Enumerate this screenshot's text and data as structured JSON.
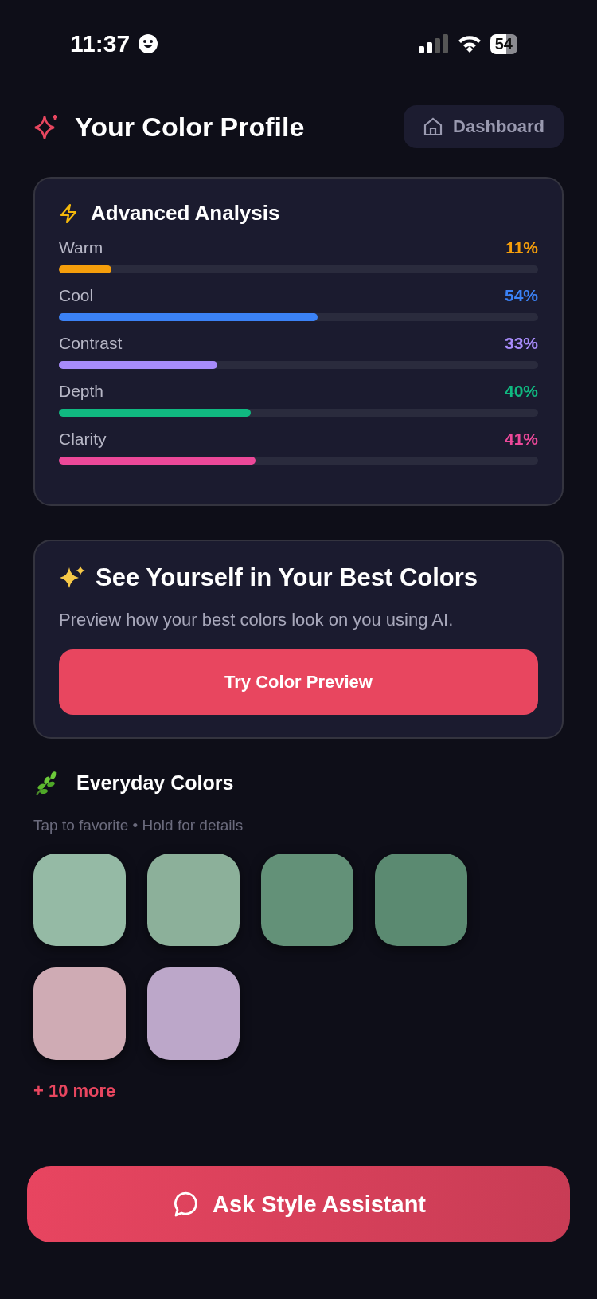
{
  "status_bar": {
    "time": "11:37",
    "battery": "54"
  },
  "header": {
    "title": "Your Color Profile",
    "dashboard_button": "Dashboard"
  },
  "analysis": {
    "title": "Advanced Analysis",
    "metrics": [
      {
        "name": "Warm",
        "reading": "11%",
        "level": 0.11,
        "color": "#f59e0b"
      },
      {
        "name": "Cool",
        "reading": "54%",
        "level": 0.54,
        "color": "#3b82f6"
      },
      {
        "name": "Contrast",
        "reading": "33%",
        "level": 0.33,
        "color": "#a78bfa"
      },
      {
        "name": "Depth",
        "reading": "40%",
        "level": 0.4,
        "color": "#10b981"
      },
      {
        "name": "Clarity",
        "reading": "41%",
        "level": 0.41,
        "color": "#ec4899"
      }
    ]
  },
  "preview": {
    "title": "See Yourself in Your Best Colors",
    "text": "Preview how your best colors look on you using AI.",
    "button": "Try Color Preview"
  },
  "everyday": {
    "title": "Everyday Colors",
    "hint": "Tap to favorite • Hold for details",
    "swatches": [
      {
        "color": "#95baa5"
      },
      {
        "color": "#8cb09a"
      },
      {
        "color": "#639178"
      },
      {
        "color": "#5b8a71"
      },
      {
        "color": "#cfabb4"
      },
      {
        "color": "#bca7c9"
      }
    ],
    "more": "+ 10 more"
  },
  "assistant_button": "Ask Style Assistant"
}
